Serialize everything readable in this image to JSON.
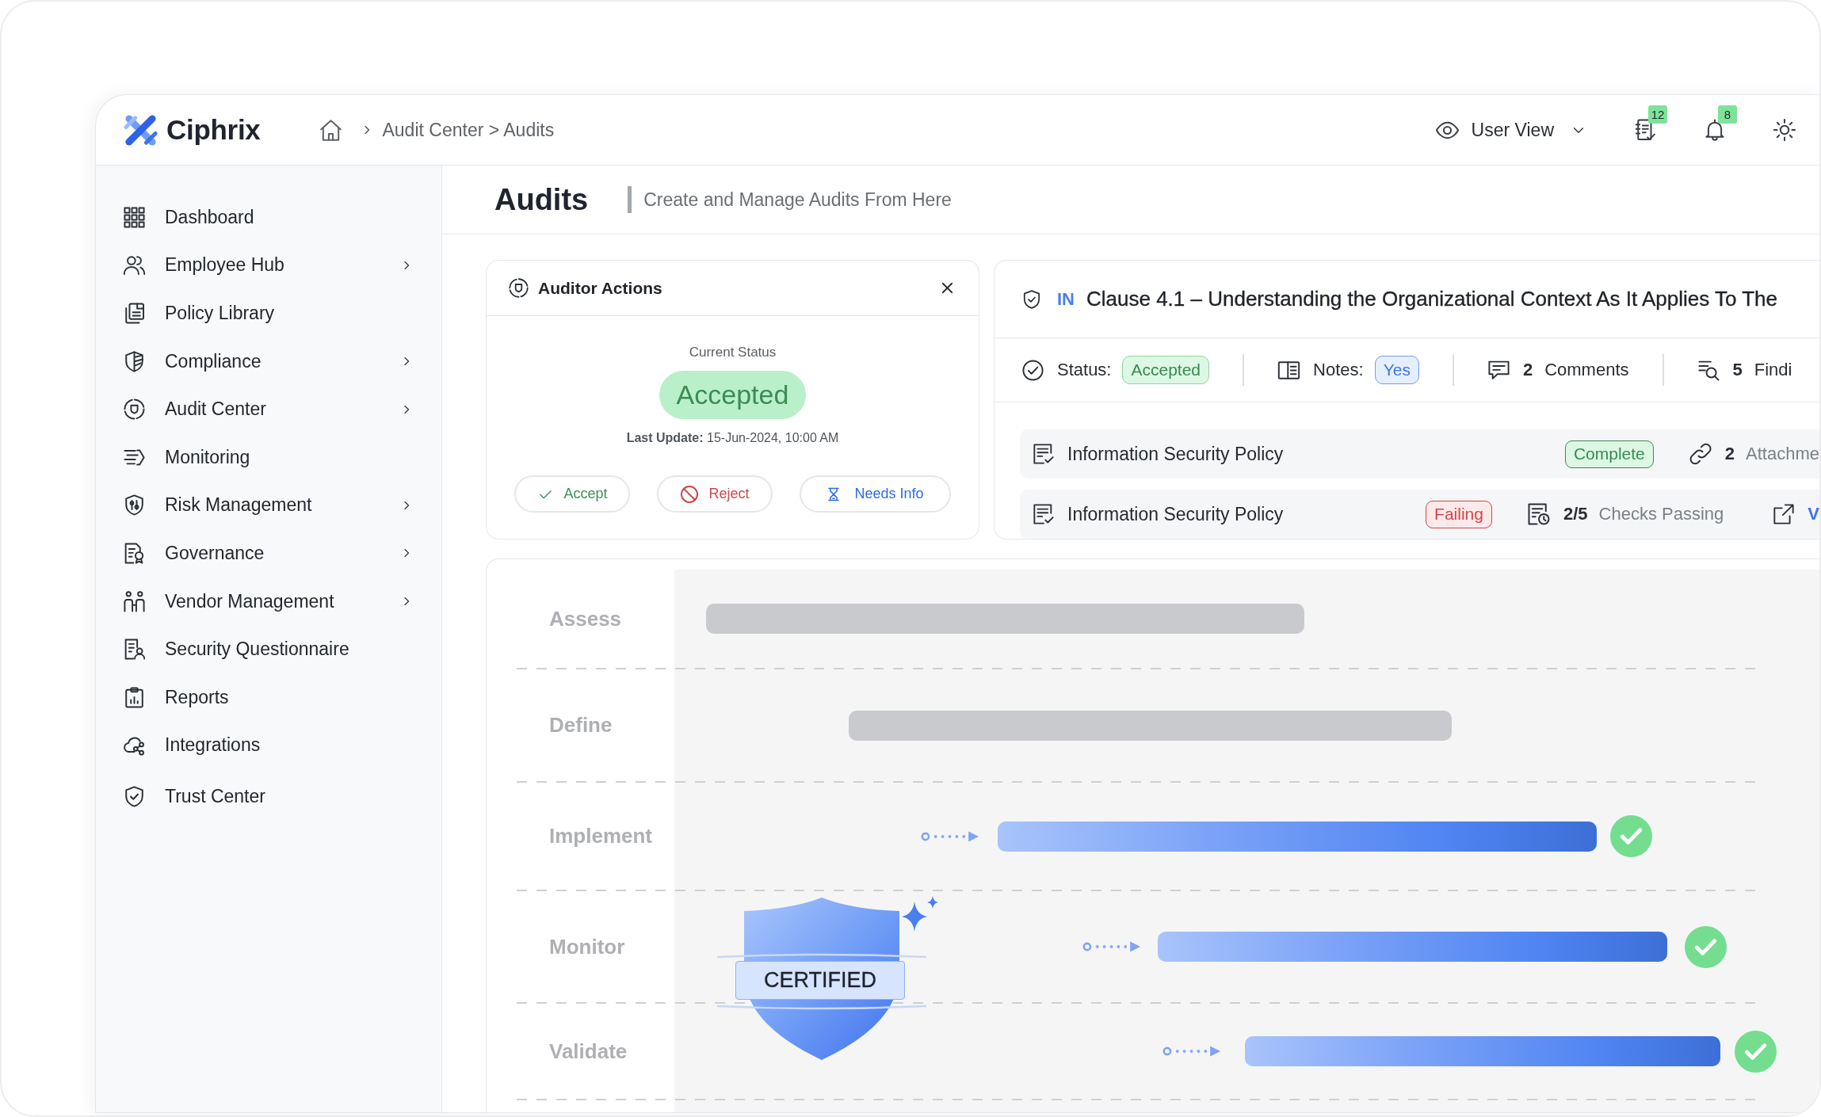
{
  "header": {
    "brand": "Ciphrix",
    "breadcrumb": "Audit Center > Audits",
    "view_selector": "User View",
    "actions": [
      {
        "kind": "tasks",
        "badge": "12"
      },
      {
        "kind": "notifications",
        "badge": "8"
      },
      {
        "kind": "theme"
      }
    ]
  },
  "sidebar": {
    "items": [
      {
        "label": "Dashboard",
        "has_submenu": false,
        "selected": false
      },
      {
        "label": "Employee Hub",
        "has_submenu": true,
        "selected": false
      },
      {
        "label": "Policy Library",
        "has_submenu": false,
        "selected": false
      },
      {
        "label": "Compliance",
        "has_submenu": true,
        "selected": false
      },
      {
        "label": "Audit Center",
        "has_submenu": true,
        "selected": false
      },
      {
        "label": "Monitoring",
        "has_submenu": false,
        "selected": false
      },
      {
        "label": "Risk Management",
        "has_submenu": true,
        "selected": false
      },
      {
        "label": "Governance",
        "has_submenu": true,
        "selected": false
      },
      {
        "label": "Vendor Management",
        "has_submenu": true,
        "selected": false
      },
      {
        "label": "Security Questionnaire",
        "has_submenu": false,
        "selected": false
      },
      {
        "label": "Reports",
        "has_submenu": false,
        "selected": false
      },
      {
        "label": "Integrations",
        "has_submenu": false,
        "selected": false
      },
      {
        "label": "Trust Center",
        "has_submenu": false,
        "selected": false
      }
    ]
  },
  "page": {
    "title": "Audits",
    "subtitle": "Create and Manage Audits From Here"
  },
  "auditor_actions": {
    "title": "Auditor Actions",
    "status_caption": "Current Status",
    "status": "Accepted",
    "last_update": "**Last Update:** 15-Jun-2024, 10:00 AM",
    "buttons": [
      {
        "kind": "accept",
        "label": "Accept"
      },
      {
        "kind": "reject",
        "label": "Reject"
      },
      {
        "kind": "needs_info",
        "label": "Needs Info"
      }
    ]
  },
  "clause": {
    "tag": "IN",
    "title": "Clause 4.1 – Understanding the Organizational Context As It Applies To The",
    "stats": [
      {
        "kind": "status",
        "label": "Status:",
        "badge": "Accepted"
      },
      {
        "kind": "notes",
        "label": "Notes:",
        "badge": "Yes"
      },
      {
        "kind": "comments",
        "count": "2",
        "label": "Comments"
      },
      {
        "kind": "findings",
        "count": "5",
        "label": "Findi"
      }
    ],
    "items": [
      {
        "title": "Information Security Policy",
        "status": {
          "kind": "complete",
          "text": "Complete"
        },
        "metric": {
          "kind": "attachments",
          "count": "2",
          "label": "Attachme"
        }
      },
      {
        "title": "Information Security Policy",
        "status": {
          "kind": "failing",
          "text": "Failing"
        },
        "metric": {
          "kind": "checks",
          "count": "2/5",
          "label": "Checks Passing"
        },
        "link": "V"
      }
    ]
  },
  "timeline": {
    "stages": [
      {
        "label": "Assess",
        "completed": false
      },
      {
        "label": "Define",
        "completed": false
      },
      {
        "label": "Implement",
        "completed": true
      },
      {
        "label": "Monitor",
        "completed": true
      },
      {
        "label": "Validate",
        "completed": true
      }
    ],
    "certified_label": "CERTIFIED"
  }
}
